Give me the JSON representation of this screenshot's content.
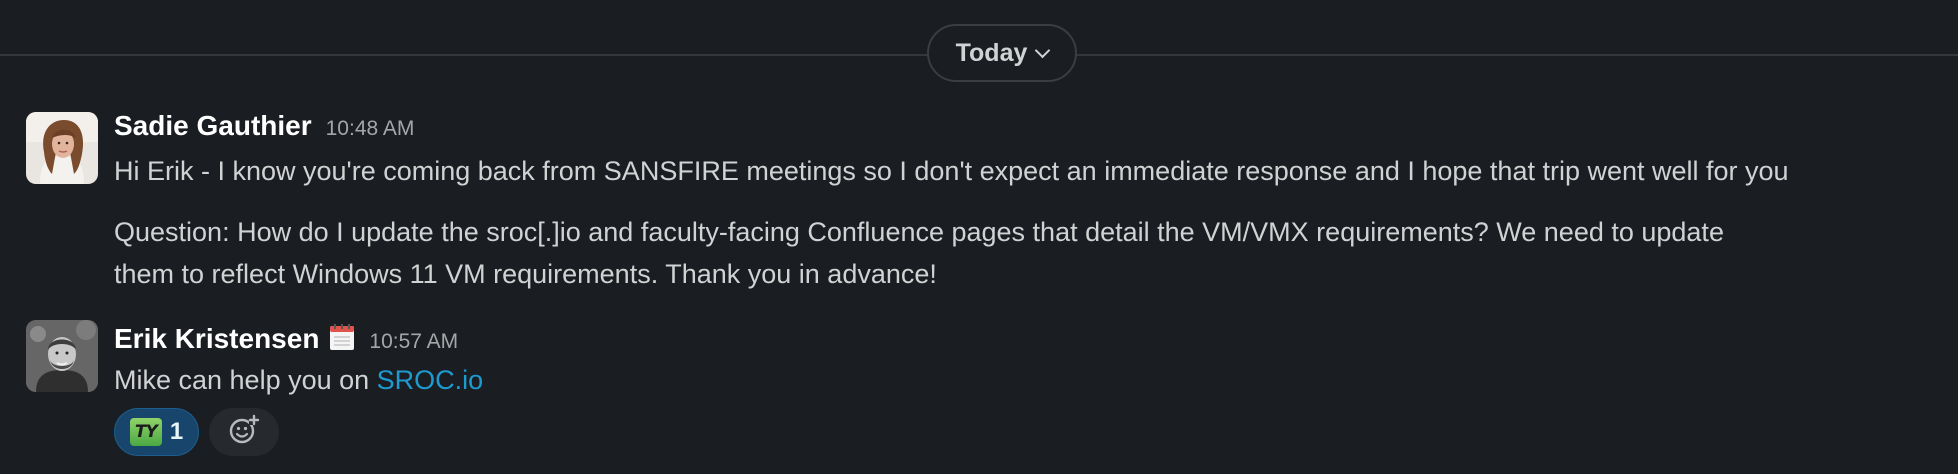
{
  "date_divider": {
    "label": "Today",
    "chevron_icon": "chevron-down-icon"
  },
  "messages": [
    {
      "author": "Sadie Gauthier",
      "time": "10:48 AM",
      "avatar": "avatar-photo",
      "paragraphs": [
        "Hi Erik - I know you're coming back from SANSFIRE meetings so I don't expect an immediate response and I hope that trip went well for you",
        "Question:  How do I update the sroc[.]io and faculty-facing Confluence pages that detail the VM/VMX requirements? We need to update",
        "them to reflect Windows 11 VM requirements. Thank you in advance!"
      ]
    },
    {
      "author": "Erik Kristensen",
      "status_icon": "calendar-icon",
      "time": "10:57 AM",
      "avatar": "avatar-photo",
      "text_prefix": "Mike can help you on ",
      "link_text": "SROC.io",
      "reactions": [
        {
          "emoji_label": "TY",
          "count": "1"
        }
      ],
      "add_reaction_icon": "add-reaction-icon"
    }
  ],
  "colors": {
    "background": "#1a1d21",
    "text": "#d1d2d3",
    "link": "#1d9bd1",
    "reaction_bg": "#17456b"
  }
}
